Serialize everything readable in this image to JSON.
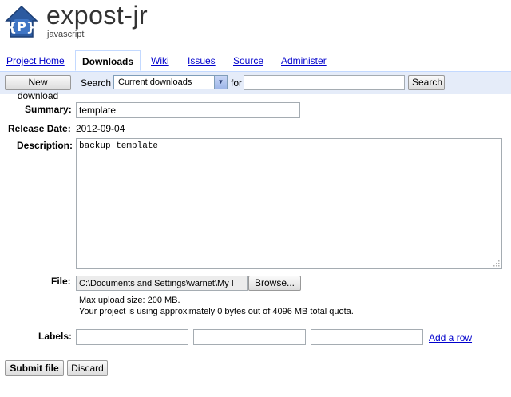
{
  "header": {
    "logo_letter": "P",
    "project_name": "expost-jr",
    "project_summary": "javascript"
  },
  "tabs": [
    {
      "label": "Project Home",
      "active": false
    },
    {
      "label": "Downloads",
      "active": true
    },
    {
      "label": "Wiki",
      "active": false
    },
    {
      "label": "Issues",
      "active": false
    },
    {
      "label": "Source",
      "active": false
    },
    {
      "label": "Administer",
      "active": false
    }
  ],
  "toolbar": {
    "new_download_label": "New download",
    "search_label": "Search",
    "search_scope_value": "Current downloads",
    "for_label": "for",
    "search_query": "",
    "search_button_label": "Search"
  },
  "form": {
    "summary_label": "Summary:",
    "summary_value": "template",
    "release_date_label": "Release Date:",
    "release_date_value": "2012-09-04",
    "description_label": "Description:",
    "description_value": "backup template",
    "file_label": "File:",
    "file_path_value": "C:\\Documents and Settings\\warnet\\My I",
    "browse_label": "Browse...",
    "max_upload_note": "Max upload size: 200 MB.",
    "quota_note": "Your project is using approximately 0 bytes out of 4096 MB total quota.",
    "labels_label": "Labels:",
    "label_values": [
      "",
      "",
      ""
    ],
    "add_row_label": "Add a row",
    "submit_label": "Submit file",
    "discard_label": "Discard"
  },
  "colors": {
    "toolbar_bg": "#e5ecf9",
    "tab_border": "#c3d9ff",
    "link": "#0000cc",
    "logo_blue": "#2c5aa0"
  }
}
